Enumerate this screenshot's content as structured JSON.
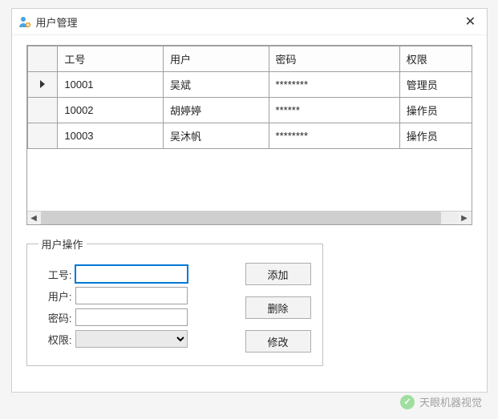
{
  "window": {
    "title": "用户管理"
  },
  "grid": {
    "columns": {
      "id": "工号",
      "user": "用户",
      "pwd": "密码",
      "role": "权限"
    },
    "rows": [
      {
        "id": "10001",
        "user": "吴斌",
        "pwd": "********",
        "role": "管理员"
      },
      {
        "id": "10002",
        "user": "胡婷婷",
        "pwd": "******",
        "role": "操作员"
      },
      {
        "id": "10003",
        "user": "吴沐帆",
        "pwd": "********",
        "role": "操作员"
      }
    ]
  },
  "ops": {
    "legend": "用户操作",
    "labels": {
      "id": "工号:",
      "user": "用户:",
      "pwd": "密码:",
      "role": "权限:"
    },
    "values": {
      "id": "",
      "user": "",
      "pwd": "",
      "role": ""
    },
    "buttons": {
      "add": "添加",
      "del": "删除",
      "mod": "修改"
    }
  },
  "watermark": {
    "text": "天眼机器视觉"
  }
}
